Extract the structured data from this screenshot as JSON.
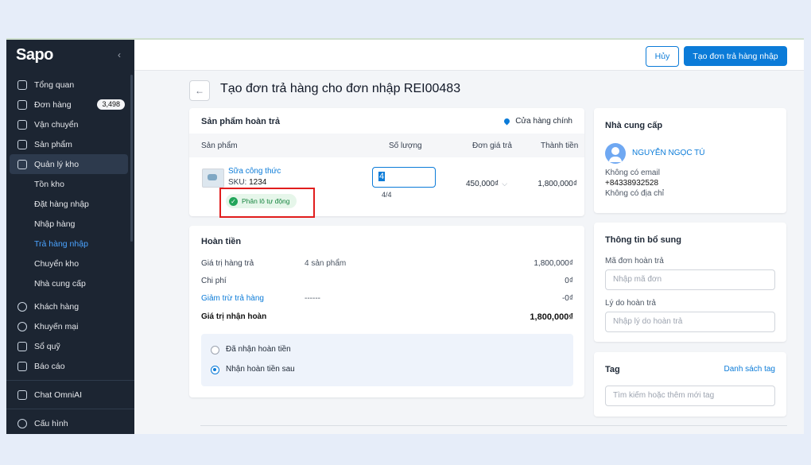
{
  "sidebar": {
    "logo": "Sapo",
    "collapse_icon": "‹",
    "items": [
      {
        "label": "Tổng quan",
        "icon": "home-icon"
      },
      {
        "label": "Đơn hàng",
        "icon": "order-icon",
        "badge": "3,498"
      },
      {
        "label": "Vận chuyển",
        "icon": "truck-icon"
      },
      {
        "label": "Sản phẩm",
        "icon": "box-icon"
      },
      {
        "label": "Quản lý kho",
        "icon": "warehouse-icon"
      }
    ],
    "sub_items": [
      "Tồn kho",
      "Đặt hàng nhập",
      "Nhập hàng",
      "Trả hàng nhập",
      "Chuyển kho",
      "Nhà cung cấp"
    ],
    "items2": [
      {
        "label": "Khách hàng",
        "icon": "user-icon"
      },
      {
        "label": "Khuyến mại",
        "icon": "promo-icon"
      },
      {
        "label": "Sổ quỹ",
        "icon": "cashbook-icon"
      },
      {
        "label": "Báo cáo",
        "icon": "chart-icon"
      }
    ],
    "chat": "Chat OmniAI",
    "config": "Cấu hình"
  },
  "topbar": {
    "cancel": "Hủy",
    "primary": "Tạo đơn trả hàng nhập"
  },
  "page": {
    "back_icon": "←",
    "title": "Tạo đơn trả hàng cho đơn nhập REI00483"
  },
  "products": {
    "title": "Sản phẩm hoàn trả",
    "store": "Cửa hàng chính",
    "headers": [
      "Sản phẩm",
      "Số lượng",
      "Đơn giá trả",
      "Thành tiền"
    ],
    "item": {
      "name": "Sữa công thức",
      "sku_label": "SKU:",
      "sku": "1234",
      "qty": "4",
      "qty_ratio": "4/4",
      "price": "450,000₫",
      "total": "1,800,000₫",
      "lot_badge": "Phân lô tự động"
    }
  },
  "refund": {
    "title": "Hoàn tiền",
    "rows": [
      {
        "label": "Giá trị hàng trả",
        "mid": "4 sản phẩm",
        "value": "1,800,000₫"
      },
      {
        "label": "Chi phí",
        "mid": "",
        "value": "0₫"
      },
      {
        "label": "Giảm trừ trả hàng",
        "mid": "------",
        "value": "-0₫"
      },
      {
        "label": "Giá trị nhận hoàn",
        "mid": "",
        "value": "1,800,000₫"
      }
    ],
    "options": [
      "Đã nhận hoàn tiền",
      "Nhận hoàn tiền sau"
    ],
    "selected_option": 1
  },
  "supplier": {
    "title": "Nhà cung cấp",
    "name": "NGUYỄN NGỌC TÚ",
    "email": "Không có email",
    "phone": "+84338932528",
    "address": "Không có địa chỉ"
  },
  "extra": {
    "title": "Thông tin bổ sung",
    "return_code_label": "Mã đơn hoàn trả",
    "return_code_placeholder": "Nhập mã đơn",
    "reason_label": "Lý do hoàn trả",
    "reason_placeholder": "Nhập lý do hoàn trả"
  },
  "tag": {
    "title": "Tag",
    "link": "Danh sách tag",
    "placeholder": "Tìm kiếm hoặc thêm mới tag"
  },
  "colors": {
    "primary": "#0b7bd8",
    "sidebar": "#1c2532",
    "success": "#16843f",
    "highlight": "#e11d1d"
  }
}
